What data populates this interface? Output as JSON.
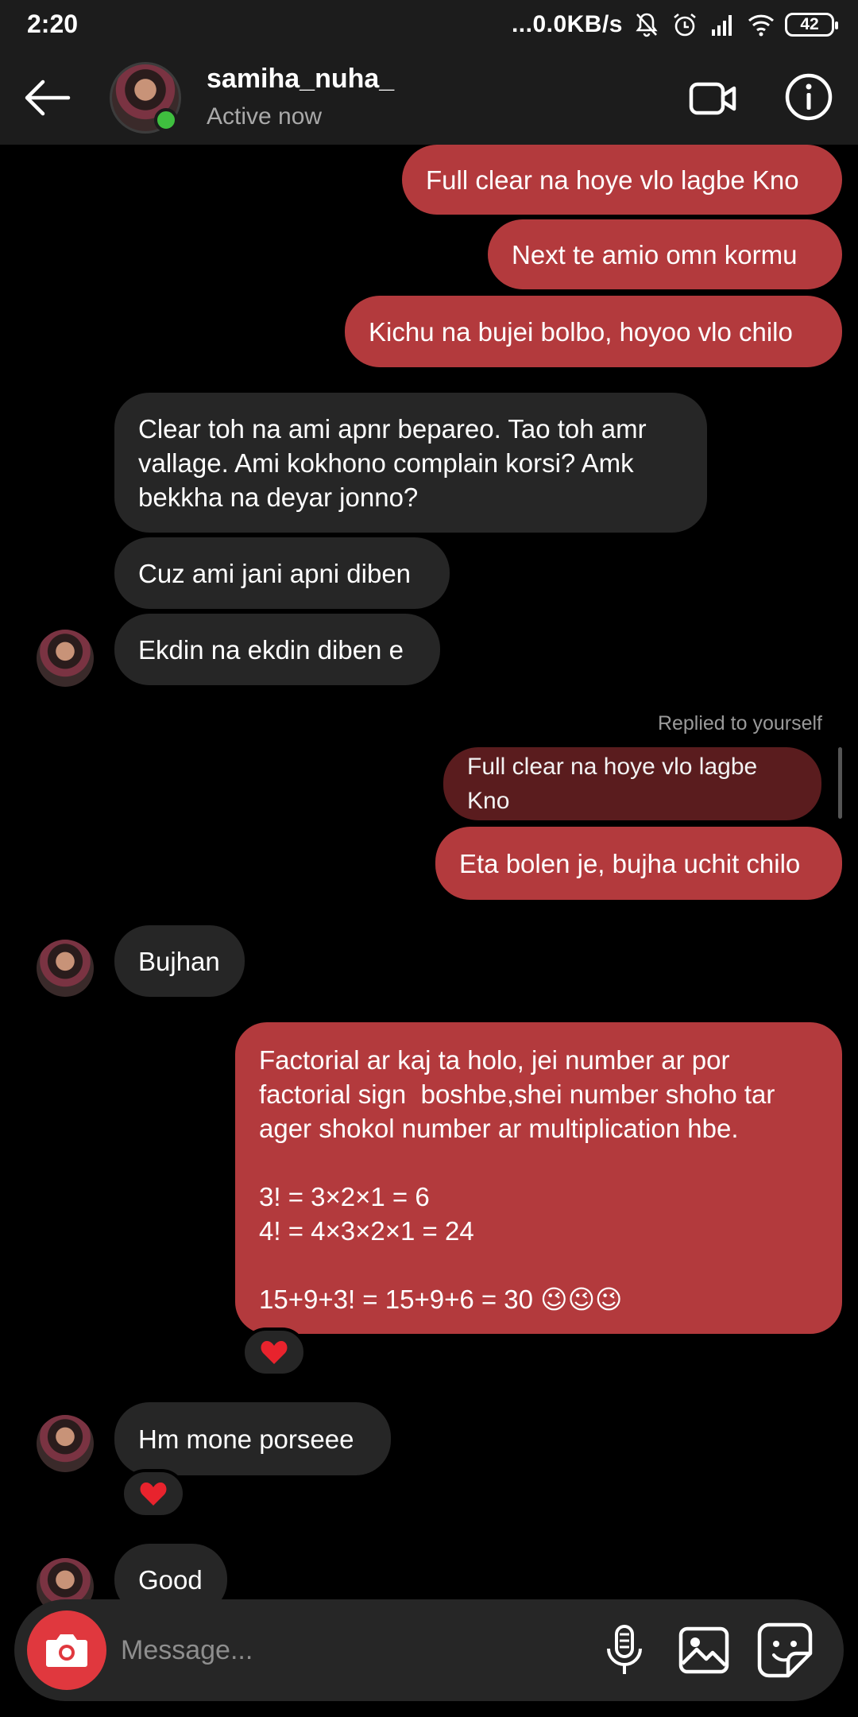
{
  "status_bar": {
    "time": "2:20",
    "network_speed": "...0.0KB/s",
    "battery": "42"
  },
  "header": {
    "username": "samiha_nuha_",
    "status": "Active now"
  },
  "messages": [
    {
      "from": "me",
      "text": "Full clear na hoye vlo lagbe Kno"
    },
    {
      "from": "me",
      "text": "Next te amio omn kormu"
    },
    {
      "from": "me",
      "text": "Kichu na bujei bolbo, hoyoo vlo chilo"
    },
    {
      "from": "them",
      "text": "Clear toh na ami apnr bepareo. Tao toh amr vallage. Ami kokhono complain korsi? Amk bekkha na deyar jonno?"
    },
    {
      "from": "them",
      "text": "Cuz ami jani apni diben"
    },
    {
      "from": "them",
      "text": "Ekdin na ekdin diben e"
    },
    {
      "from": "me",
      "text": "Eta bolen je, bujha uchit chilo",
      "reply_label": "Replied to yourself",
      "quoted": "Full clear na hoye vlo lagbe Kno"
    },
    {
      "from": "them",
      "text": "Bujhan"
    },
    {
      "from": "me",
      "text": "Factorial ar kaj ta holo, jei number ar por factorial sign  boshbe,shei number shoho tar ager shokol number ar multiplication hbe.\n\n3! = 3×2×1 = 6\n4! = 4×3×2×1 = 24\n\n15+9+3! = 15+9+6 = 30 😉😉😉",
      "reaction": "❤️"
    },
    {
      "from": "them",
      "text": "Hm mone porseee",
      "reaction": "❤️"
    },
    {
      "from": "them",
      "text": "Good"
    }
  ],
  "composer": {
    "placeholder": "Message..."
  },
  "colors": {
    "outgoing_bubble": "#b33a3d",
    "incoming_bubble": "#262626",
    "camera_button": "#e0383e",
    "online": "#3fbf3f"
  },
  "icons": [
    "back-arrow-icon",
    "video-call-icon",
    "info-icon",
    "camera-icon",
    "microphone-icon",
    "gallery-icon",
    "sticker-icon",
    "heart-icon"
  ]
}
